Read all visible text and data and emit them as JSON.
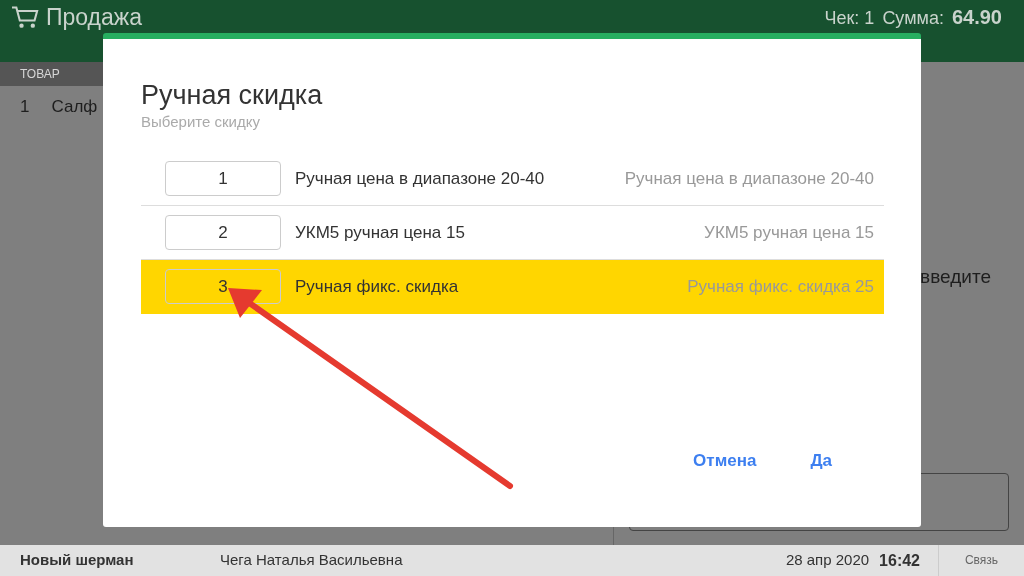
{
  "header": {
    "title": "Продажа",
    "check": "Чек: 1",
    "sum_label": "Сумма:",
    "sum": "64.90"
  },
  "table": {
    "columns": [
      "ТОВАР"
    ],
    "rows": [
      {
        "number": "1",
        "name": "Салф"
      }
    ]
  },
  "side_panel": {
    "prompt": "введите"
  },
  "dialog": {
    "title": "Ручная скидка",
    "subtitle": "Выберите скидку",
    "options": [
      {
        "number": "1",
        "name": "Ручная цена в диапазоне 20-40",
        "description": "Ручная цена в диапазоне 20-40",
        "selected": false
      },
      {
        "number": "2",
        "name": "УКМ5 ручная цена 15",
        "description": "УКМ5 ручная цена 15",
        "selected": false
      },
      {
        "number": "3",
        "name": "Ручная фикс. скидка",
        "description": "Ручная фикс. скидка 25",
        "selected": true
      }
    ],
    "buttons": [
      "Отмена",
      "Да"
    ]
  },
  "status_bar": {
    "store": "Новый шерман",
    "cashier": "Чега Наталья Васильевна",
    "date": "28 апр 2020",
    "time": "16:42",
    "connection": "Связь"
  }
}
